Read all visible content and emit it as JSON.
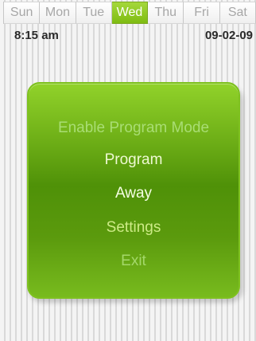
{
  "day_tabs": [
    "Sun",
    "Mon",
    "Tue",
    "Wed",
    "Thu",
    "Fri",
    "Sat"
  ],
  "selected_day": "Wed",
  "status": {
    "time": "8:15 am",
    "date": "09-02-09"
  },
  "menu": {
    "items": [
      "Enable Program Mode",
      "Program",
      "Away",
      "Settings",
      "Exit"
    ]
  },
  "colors": {
    "selected_tab": "#8cc521",
    "menu_panel": "#5d9c0d"
  }
}
